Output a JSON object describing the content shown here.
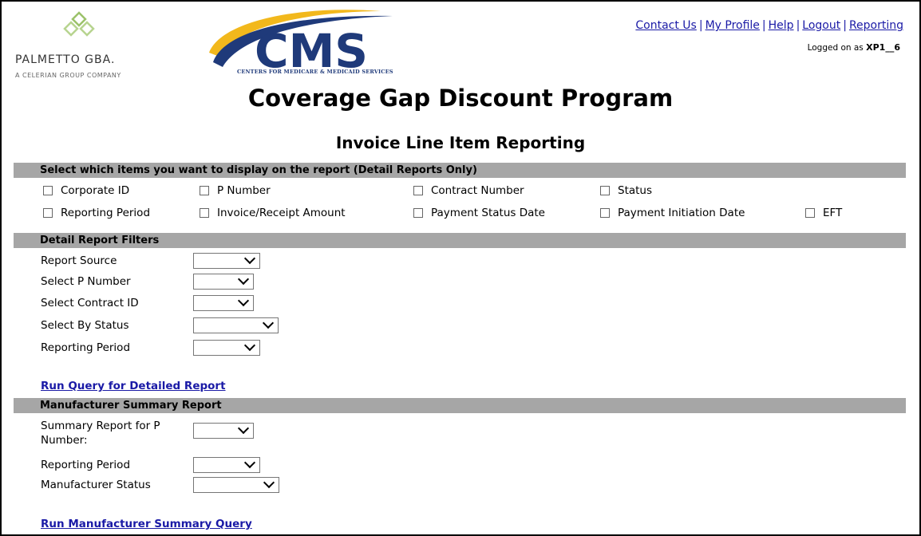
{
  "header": {
    "palmetto_name": "PALMETTO GBA.",
    "palmetto_tagline": "A CELERIAN GROUP COMPANY",
    "cms_logo_text": "CMS",
    "cms_subtitle": "CENTERS FOR MEDICARE & MEDICAID SERVICES",
    "links": [
      "Contact Us",
      "My Profile",
      "Help",
      "Logout",
      "Reporting"
    ],
    "link_separator": "|",
    "logged_on_prefix": "Logged on as",
    "logged_on_user": "XP1__6"
  },
  "page": {
    "title": "Coverage Gap Discount Program",
    "subtitle": "Invoice Line Item Reporting"
  },
  "display_section": {
    "heading": "Select which items you want to display on the report (Detail Reports Only)",
    "row1": [
      "Corporate ID",
      "P Number",
      "Contract Number",
      "Status"
    ],
    "row2": [
      "Reporting Period",
      "Invoice/Receipt Amount",
      "Payment Status Date",
      "Payment Initiation Date",
      "EFT"
    ]
  },
  "detail_filters": {
    "heading": "Detail Report Filters",
    "fields": [
      "Report Source",
      "Select P Number",
      "Select Contract ID",
      "Select By Status",
      "Reporting Period"
    ],
    "run_link": "Run Query for Detailed Report"
  },
  "summary": {
    "heading": "Manufacturer Summary Report",
    "fields": [
      "Summary Report for P Number:",
      "Reporting Period",
      "Manufacturer Status"
    ],
    "run_link": "Run Manufacturer Summary Query"
  },
  "colors": {
    "section_bar": "#a6a6a6",
    "link": "#1a1aa6",
    "cms_blue": "#1f3a7a",
    "cms_gold": "#f2b81c"
  }
}
